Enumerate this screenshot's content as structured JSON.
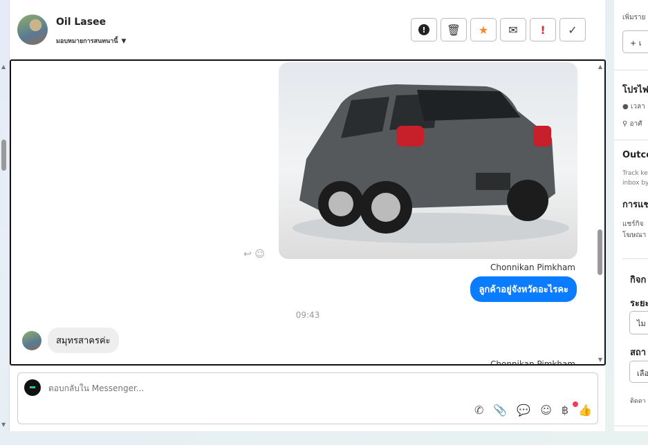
{
  "header": {
    "name": "Oil Lasee",
    "assign_label": "มอบหมายการสนทนานี้"
  },
  "actions": [
    {
      "name": "mark-spam-button",
      "icon": "!",
      "color": "#222"
    },
    {
      "name": "delete-button",
      "icon": "🗑",
      "color": "#333"
    },
    {
      "name": "star-button",
      "icon": "★",
      "color": "#f5862b"
    },
    {
      "name": "mark-unread-button",
      "icon": "✉",
      "color": "#333"
    },
    {
      "name": "follow-up-button",
      "icon": "!",
      "color": "#e02b2b"
    },
    {
      "name": "mark-done-button",
      "icon": "✓",
      "color": "#444"
    }
  ],
  "thread": {
    "sender": "Chonnikan Pimkham",
    "outgoing_message": "ลูกค้าอยู่จังหวัดอะไรคะ",
    "timestamp": "09:43",
    "incoming_message": "สมุทรสาครค่ะ",
    "sender_next": "Chonnikan Pimkham"
  },
  "composer": {
    "placeholder": "ตอบกลับใน Messenger..."
  },
  "side": {
    "add_label": "เพิ่มราย",
    "add_button": "+ เ",
    "profile_title": "โปรไฟ",
    "profile_time": "เวลา",
    "profile_location": "อาศั",
    "outcome_title": "Outco",
    "outcome_desc1": "Track ke",
    "outcome_desc2": "inbox by",
    "share_title": "การแช",
    "share_desc1": "แชร์กิจ",
    "share_desc2": "โฆษณา",
    "activity_title": "กิจก",
    "period_label": "ระยะ",
    "period_value": "ไม",
    "status_label": "สถา",
    "status_value": "เลือ",
    "track_note": "ติดตา"
  },
  "colors": {
    "accent": "#0a7cff",
    "star": "#f5862b",
    "alert": "#e02b2b"
  }
}
